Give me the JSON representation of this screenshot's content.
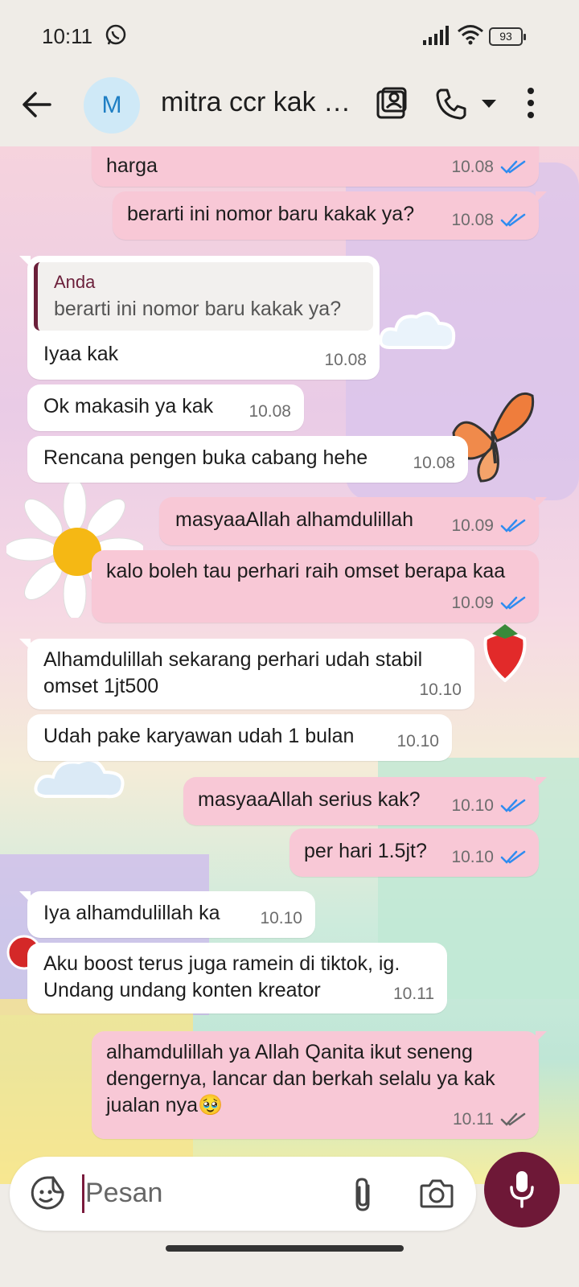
{
  "status_bar": {
    "time": "10:11",
    "battery": "93",
    "icons": [
      "whatsapp-icon",
      "signal-icon",
      "wifi-icon",
      "battery-icon"
    ]
  },
  "header": {
    "avatar_initial": "M",
    "contact_name": "mitra ccr kak r...",
    "icons": [
      "back-arrow-icon",
      "video-call-icon",
      "phone-icon",
      "chevron-down-icon",
      "more-vertical-icon"
    ]
  },
  "messages": [
    {
      "dir": "out",
      "text": "harga",
      "time": "10.08",
      "status": "read"
    },
    {
      "dir": "out",
      "text": "berarti ini nomor baru kakak ya?",
      "time": "10.08",
      "status": "read"
    },
    {
      "dir": "in",
      "quote_author": "Anda",
      "quote_text": "berarti ini nomor baru kakak ya?",
      "text": "Iyaa kak",
      "time": "10.08"
    },
    {
      "dir": "in",
      "text": "Ok makasih ya kak",
      "time": "10.08"
    },
    {
      "dir": "in",
      "text": "Rencana pengen buka cabang hehe",
      "time": "10.08"
    },
    {
      "dir": "out",
      "text": "masyaaAllah alhamdulillah",
      "time": "10.09",
      "status": "read"
    },
    {
      "dir": "out",
      "text": "kalo boleh tau perhari raih omset berapa kaa",
      "time": "10.09",
      "status": "read"
    },
    {
      "dir": "in",
      "text": "Alhamdulillah sekarang perhari udah stabil omset 1jt500",
      "time": "10.10"
    },
    {
      "dir": "in",
      "text": "Udah pake karyawan udah 1 bulan",
      "time": "10.10"
    },
    {
      "dir": "out",
      "text": "masyaaAllah serius kak?",
      "time": "10.10",
      "status": "read"
    },
    {
      "dir": "out",
      "text": "per hari 1.5jt?",
      "time": "10.10",
      "status": "read"
    },
    {
      "dir": "in",
      "text": "Iya alhamdulillah ka",
      "time": "10.10"
    },
    {
      "dir": "in",
      "text": "Aku boost terus juga ramein di tiktok, ig. Undang undang konten kreator",
      "time": "10.11"
    },
    {
      "dir": "out",
      "text": "alhamdulillah ya Allah Qanita ikut seneng dengernya, lancar dan berkah selalu ya kak jualan nya🥹",
      "time": "10.11",
      "status": "delivered"
    }
  ],
  "input": {
    "placeholder": "Pesan",
    "icons": [
      "sticker-icon",
      "attach-icon",
      "camera-icon",
      "mic-icon"
    ]
  },
  "colors": {
    "outgoing_bubble": "#f8c8d6",
    "incoming_bubble": "#ffffff",
    "read_tick": "#2f8cf0",
    "delivered_tick": "#666666",
    "mic_button": "#6e1837",
    "quote_bar": "#6b1f3a"
  }
}
